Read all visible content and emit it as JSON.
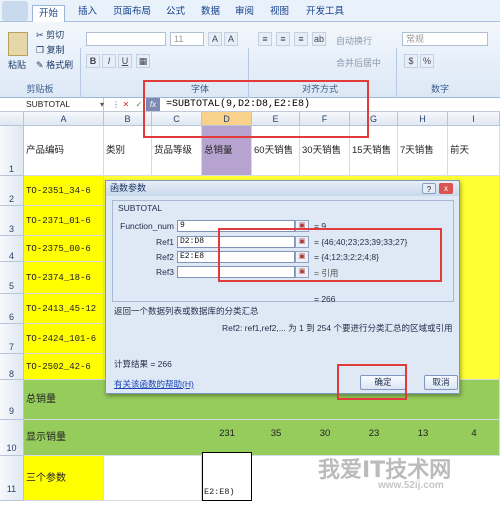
{
  "ribbon": {
    "tabs": [
      "开始",
      "插入",
      "页面布局",
      "公式",
      "数据",
      "审阅",
      "视图",
      "开发工具"
    ],
    "active_tab": "开始",
    "clipboard": {
      "paste": "粘贴",
      "cut": "剪切",
      "copy": "复制",
      "format_painter": "格式刷",
      "group": "剪贴板"
    },
    "font": {
      "size": "11",
      "bold": "B",
      "italic": "I",
      "underline": "U",
      "group": "字体"
    },
    "alignment": {
      "wrap": "自动换行",
      "merge": "合并后居中",
      "group": "对齐方式"
    },
    "number": {
      "format": "常规",
      "group": "数字"
    }
  },
  "formula_bar": {
    "name_box": "SUBTOTAL",
    "formula": "=SUBTOTAL(9,D2:D8,E2:E8)"
  },
  "grid": {
    "columns": [
      "A",
      "B",
      "C",
      "D",
      "E",
      "F",
      "G",
      "H",
      "I"
    ],
    "selected_column": "D",
    "rows": [
      "1",
      "2",
      "3",
      "4",
      "5",
      "6",
      "7",
      "8",
      "9",
      "10",
      "11"
    ],
    "headers": {
      "A": "产品编码",
      "B": "类别",
      "C": "货品等级",
      "D": "总销量",
      "E": "60天销售",
      "F": "30天销售",
      "G": "15天销售",
      "H": "7天销售",
      "I": "前天"
    },
    "codes": [
      "TO-2351_34-6",
      "TO-2371_01-6",
      "TO-2375_00-6",
      "TO-2374_18-6",
      "TO-2413_45-12",
      "TO-2424_101-6",
      "TO-2502_42-6"
    ],
    "total_label": "总销量",
    "display_label": "显示销量",
    "display_values": {
      "D": "231",
      "E": "35",
      "F": "30",
      "G": "23",
      "H": "13",
      "I": "4"
    },
    "three_params_label": "三个参数",
    "edit_cell_text": "E2:E8)"
  },
  "dialog": {
    "title": "函数参数",
    "function_name": "SUBTOTAL",
    "args": [
      {
        "label": "Function_num",
        "value": "9",
        "result": "= 9"
      },
      {
        "label": "Ref1",
        "value": "D2:D8",
        "result": "= {46;40;23;23;39;33;27}"
      },
      {
        "label": "Ref2",
        "value": "E2:E8",
        "result": "= {4;12;3;2;2;4;8}"
      },
      {
        "label": "Ref3",
        "value": "",
        "result": "= 引用"
      }
    ],
    "total_result": "= 266",
    "description": "返回一个数据列表或数据库的分类汇总",
    "ref_help": "Ref2:  ref1,ref2,... 为 1 到 254 个要进行分类汇总的区域或引用",
    "calc_result": "计算结果 =  266",
    "help_link": "有关该函数的帮助(H)",
    "ok": "确定",
    "cancel": "取消",
    "help_icon": "?",
    "close_icon": "x"
  },
  "watermark": {
    "main": "我爱IT技术网",
    "url": "www.52ij.com"
  }
}
